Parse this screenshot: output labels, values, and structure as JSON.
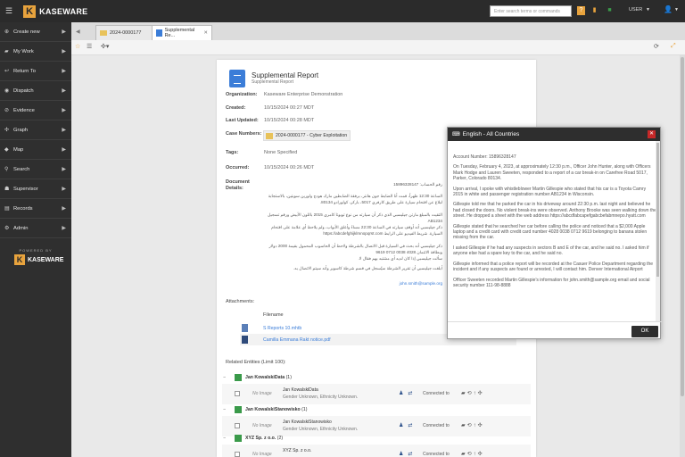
{
  "app": {
    "logo_text": "KASEWARE"
  },
  "topbar": {
    "search_placeholder": "Enter search terms or commands",
    "user_label": "USER"
  },
  "sidebar": {
    "items": [
      {
        "label": "Create new"
      },
      {
        "label": "My Work"
      },
      {
        "label": "Return To"
      },
      {
        "label": "Dispatch"
      },
      {
        "label": "Evidence"
      },
      {
        "label": "Graph"
      },
      {
        "label": "Map"
      },
      {
        "label": "Search"
      },
      {
        "label": "Supervisor"
      },
      {
        "label": "Records"
      },
      {
        "label": "Admin"
      }
    ],
    "powered_by": "POWERED BY",
    "powered_logo": "KASEWARE"
  },
  "tabs": [
    {
      "label": "2024-0000177"
    },
    {
      "label": "Supplemental Re..."
    }
  ],
  "report": {
    "title": "Supplemental Report",
    "subtitle": "Supplemental Report",
    "fields": {
      "organization_label": "Organization:",
      "organization": "Kaseware Enterprise Demonstration",
      "created_label": "Created:",
      "created": "10/15/2024 00:27 MDT",
      "last_updated_label": "Last Updated:",
      "last_updated": "10/15/2024 00:28 MDT",
      "case_numbers_label": "Case Numbers:",
      "case_number": "2024-0000177 - Cyber Exploitation",
      "tags_label": "Tags:",
      "tags": "None Specified",
      "occurred_label": "Occurred:",
      "occurred": "10/15/2024 00:26 MDT",
      "details_label": "Document Details:"
    },
    "arabic_lines": [
      "رقم الحساب: 15896328147",
      "الساعة 12:30 ظهراً، قمت أنا الضابط جون هانتر، برفقة الضابطين مارك هودج ولورين سويتين، بالاستجابة لبلاغ عن اقتحام سيارة على طريق كارفري 5017، باركر، كولورادو 80134.",
      "التقيت بالمبلغ مارتن جيليسبي الذي ذكر أن سيارته من نوع تويوتا كامري 2015 باللون الأبيض ورقم تسجيل AB1234",
      "ذكر جيليسبي أنه أوقف سيارته في الساعة 22:30 مساءً وأغلق الأبواب، ولم يلاحظ أي علامة على اقتحام السيارة. شريط الفيديو على الرابط https://abcdefghijklmnopqrst.com",
      "ذكر جيليسبي أنه بحث في السيارة قبل الاتصال بالشرطة ولاحظ أن الحاسوب المحمول بقيمة 2000 دولار وبطاقة الائتمان 4028 0038 0712 9619",
      "سألت جيليسبي إذا كان لديه أي مشتبه بهم فقال لا.",
      "أبلغت جيليسبي أن تقرير الشرطة سيُسجل في قسم شرطة كاسوير وأنه سيتم الاتصال به.",
      "سجل الضابط سويتين معلومات مارتن جيليسبي john.smith@sample.org 8888-98-111"
    ],
    "arabic_email": "john.smith@sample.org",
    "attachments_label": "Attachments:",
    "attachments_col": "Filename",
    "attachments": [
      {
        "name": "S Reports 10.mhtb"
      },
      {
        "name": "Camilla Emmana Rakt notice.pdf"
      }
    ],
    "related_label": "Related Entities (Limit 100):",
    "groups": [
      {
        "name": "Jan KowalskiData",
        "count": "(1)",
        "entity": {
          "no_image": "No Image",
          "name": "Jan KowalskiData",
          "desc": "Gender Unknown, Ethnicity Unknown.",
          "connected": "Connected to"
        }
      },
      {
        "name": "Jan KowalskiStanowisko",
        "count": "(1)",
        "entity": {
          "no_image": "No Image",
          "name": "Jan KowalskiStanowisko",
          "desc": "Gender Unknown, Ethnicity Unknown.",
          "connected": "Connected to"
        }
      },
      {
        "name": "XYZ Sp. z o.o.",
        "count": "(2)",
        "entity": {
          "no_image": "No Image",
          "name": "XYZ Sp. z o.o.",
          "desc": "",
          "connected": "Connected to"
        }
      }
    ]
  },
  "modal": {
    "title": "English - All Countries",
    "paragraphs": [
      "Account Number: 15896328147",
      "On Tuesday, February 4, 2023, at approximately 12:30 p.m., Officer John Hunter, along with Officers Mark Hodge and Lauren Sweeten, responded to a report of a car break-in on Carefree Road 5017, Parker, Colorado 80134.",
      "Upon arrival, I spoke with whistleblower Martin Gillespie who stated that his car is a Toyota Camry 2015 in white and passenger registration number AB1234 in Wisconsin.",
      "Gillespie told me that he parked the car in his driveway around 22:30 p.m. last night and believed he had closed the doors. No violent break-ins were observed. Anthony Brooke was seen walking down the street. He dropped a sheet with the web address https://abcdfabcapefgabcbefabmnepo.hyatt.com",
      "Gillespie stated that he searched her car before calling the police and noticed that a $2,000 Apple laptop and a credit card with credit card number 4028 0038 0712 9619 belonging to banana stolen missing from the car.",
      "I asked Gillespie if he had any suspects in sectors B and E of the car, and he said no. I asked him if anyone else had a spare key to the car, and he said no.",
      "Gillespie informed that a police report will be recorded at the Casuer Police Department regarding the incident and if any suspects are found or arrested, I will contact him. Denver International Airport",
      "Officer Sweeten recorded Martin Gillespie's information for john.smith@sample.org email and social security number 111-98-8888"
    ],
    "ok_label": "OK"
  }
}
